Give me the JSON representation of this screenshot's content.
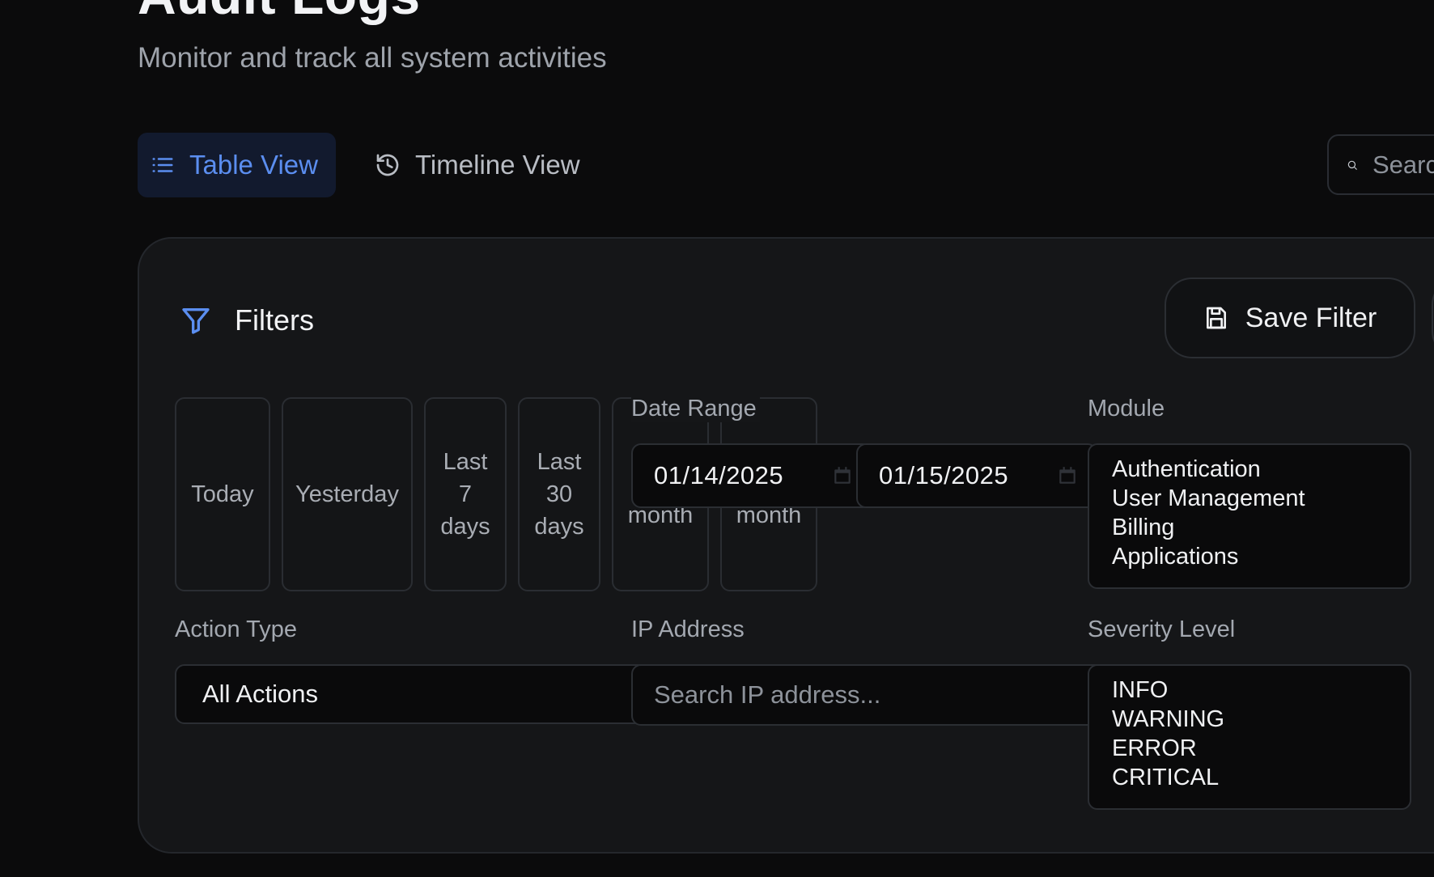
{
  "header": {
    "title": "Audit Logs",
    "subtitle": "Monitor and track all system activities"
  },
  "view_tabs": [
    {
      "label": "Table View",
      "icon": "list-icon",
      "active": true
    },
    {
      "label": "Timeline View",
      "icon": "history-icon",
      "active": false
    }
  ],
  "search": {
    "placeholder": "Search logs..."
  },
  "filters": {
    "title": "Filters",
    "save_label": "Save Filter",
    "quick_ranges": [
      [
        "Today"
      ],
      [
        "Yesterday"
      ],
      [
        "Last",
        "7",
        "days"
      ],
      [
        "Last",
        "30",
        "days"
      ],
      [
        "month"
      ],
      [
        "month"
      ]
    ],
    "date_range": {
      "label": "Date Range",
      "start": "01/14/2025",
      "end": "01/15/2025"
    },
    "module": {
      "label": "Module",
      "options": [
        "Authentication",
        "User Management",
        "Billing",
        "Applications"
      ]
    },
    "action_type": {
      "label": "Action Type",
      "selected": "All Actions"
    },
    "ip_address": {
      "label": "IP Address",
      "placeholder": "Search IP address..."
    },
    "severity": {
      "label": "Severity Level",
      "options": [
        "INFO",
        "WARNING",
        "ERROR",
        "CRITICAL"
      ]
    }
  },
  "colors": {
    "accent": "#5b8ef0",
    "background": "#0b0b0c",
    "panel": "#151618"
  }
}
